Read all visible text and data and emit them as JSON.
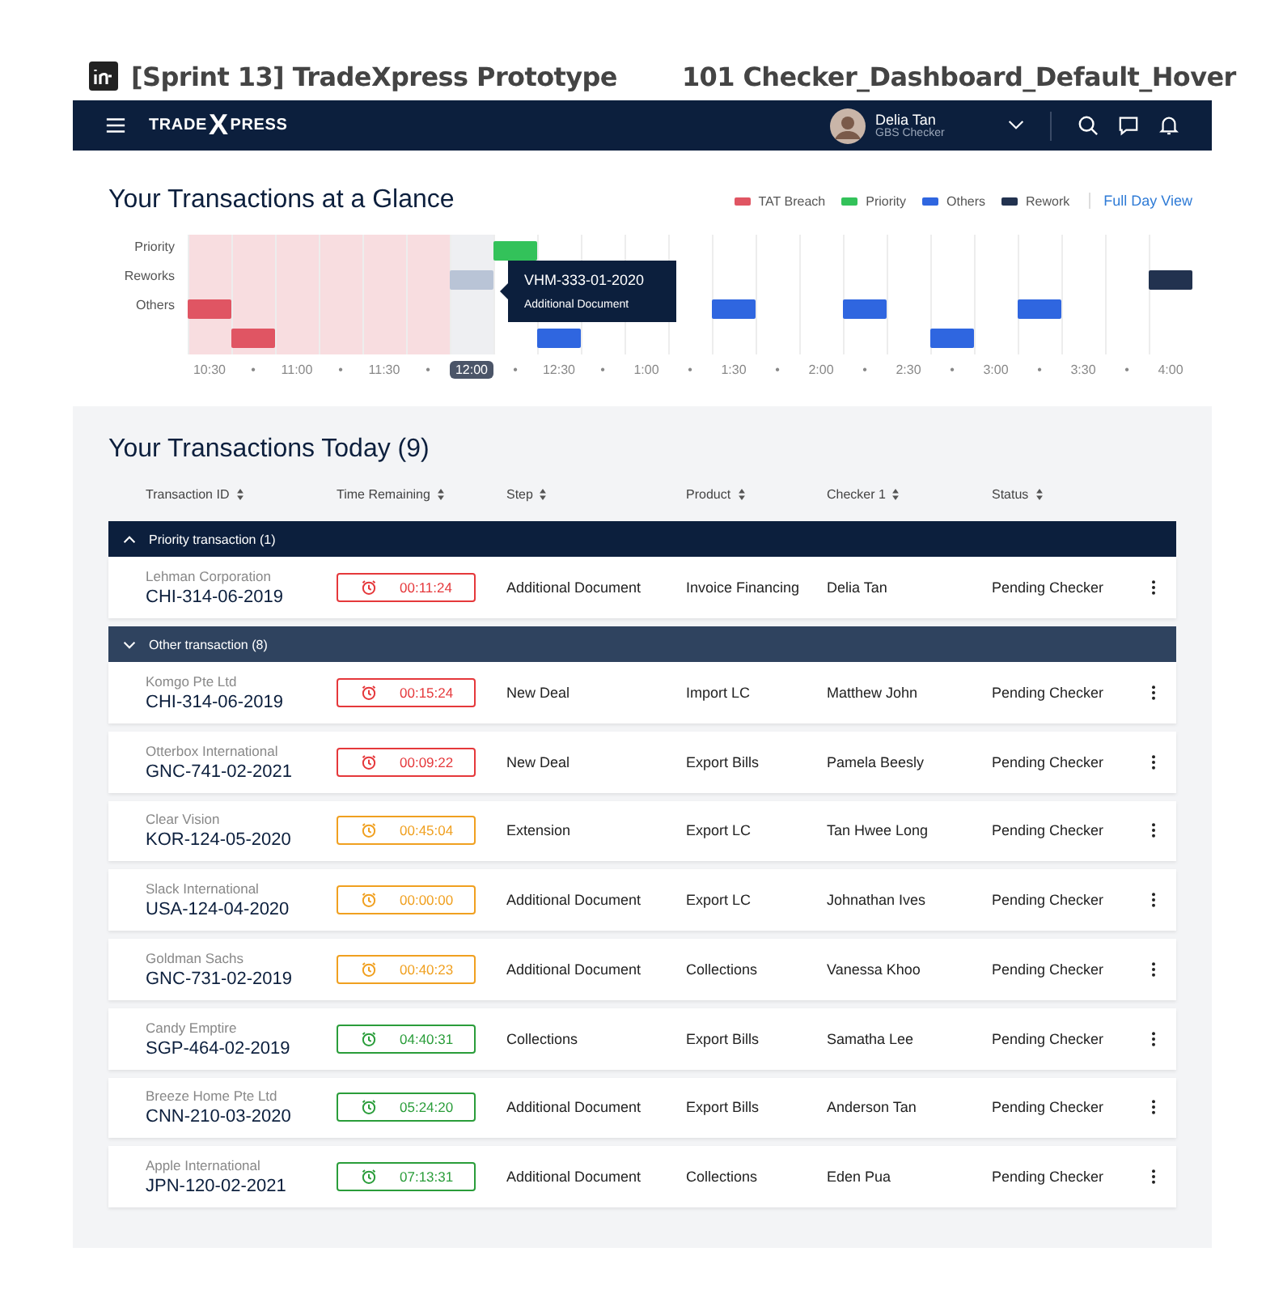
{
  "prototype": {
    "title": "[Sprint 13] TradeXpress Prototype",
    "screen": "101 Checker_Dashboard_Default_Hover"
  },
  "navbar": {
    "logo_left": "TRADE",
    "logo_mark": "X",
    "logo_right": "PRESS",
    "user": {
      "name": "Delia Tan",
      "role": "GBS Checker"
    }
  },
  "glance": {
    "title": "Your Transactions at a Glance",
    "legend": [
      {
        "label": "TAT Breach",
        "kind": "tat_breach"
      },
      {
        "label": "Priority",
        "kind": "priority"
      },
      {
        "label": "Others",
        "kind": "others"
      },
      {
        "label": "Rework",
        "kind": "rework"
      }
    ],
    "full_day_link": "Full Day View",
    "columns": [
      {
        "tick": "10:30",
        "past": true,
        "selected": false
      },
      {
        "tick": "•",
        "past": true,
        "selected": false
      },
      {
        "tick": "11:00",
        "past": true,
        "selected": false
      },
      {
        "tick": "•",
        "past": true,
        "selected": false
      },
      {
        "tick": "11:30",
        "past": true,
        "selected": false
      },
      {
        "tick": "•",
        "past": true,
        "selected": false
      },
      {
        "tick": "12:00",
        "past": false,
        "selected": true
      },
      {
        "tick": "•",
        "past": false,
        "selected": false
      },
      {
        "tick": "12:30",
        "past": false,
        "selected": false
      },
      {
        "tick": "•",
        "past": false,
        "selected": false
      },
      {
        "tick": "1:00",
        "past": false,
        "selected": false
      },
      {
        "tick": "•",
        "past": false,
        "selected": false
      },
      {
        "tick": "1:30",
        "past": false,
        "selected": false
      },
      {
        "tick": "•",
        "past": false,
        "selected": false
      },
      {
        "tick": "2:00",
        "past": false,
        "selected": false
      },
      {
        "tick": "•",
        "past": false,
        "selected": false
      },
      {
        "tick": "2:30",
        "past": false,
        "selected": false
      },
      {
        "tick": "•",
        "past": false,
        "selected": false
      },
      {
        "tick": "3:00",
        "past": false,
        "selected": false
      },
      {
        "tick": "•",
        "past": false,
        "selected": false
      },
      {
        "tick": "3:30",
        "past": false,
        "selected": false
      },
      {
        "tick": "•",
        "past": false,
        "selected": false
      },
      {
        "tick": "4:00",
        "past": false,
        "selected": false
      }
    ],
    "lanes": [
      {
        "label": "Priority",
        "slots": [
          {
            "kind": "none"
          },
          {
            "kind": "none"
          },
          {
            "kind": "none"
          },
          {
            "kind": "none"
          },
          {
            "kind": "none"
          },
          {
            "kind": "none"
          },
          {
            "kind": "none"
          },
          {
            "kind": "priority",
            "hovered": false
          },
          {
            "kind": "none"
          },
          {
            "kind": "none"
          },
          {
            "kind": "none"
          },
          {
            "kind": "none"
          },
          {
            "kind": "none"
          },
          {
            "kind": "none"
          },
          {
            "kind": "none"
          },
          {
            "kind": "none"
          },
          {
            "kind": "none"
          },
          {
            "kind": "none"
          },
          {
            "kind": "none"
          },
          {
            "kind": "none"
          },
          {
            "kind": "none"
          },
          {
            "kind": "none"
          },
          {
            "kind": "none"
          }
        ]
      },
      {
        "label": "Reworks",
        "slots": [
          {
            "kind": "none"
          },
          {
            "kind": "none"
          },
          {
            "kind": "none"
          },
          {
            "kind": "none"
          },
          {
            "kind": "none"
          },
          {
            "kind": "none"
          },
          {
            "kind": "rework",
            "hovered": true,
            "tooltip": {
              "id": "VHM-333-01-2020",
              "step": "Additional Document"
            }
          },
          {
            "kind": "none"
          },
          {
            "kind": "none"
          },
          {
            "kind": "none"
          },
          {
            "kind": "none"
          },
          {
            "kind": "none"
          },
          {
            "kind": "none"
          },
          {
            "kind": "none"
          },
          {
            "kind": "none"
          },
          {
            "kind": "none"
          },
          {
            "kind": "none"
          },
          {
            "kind": "none"
          },
          {
            "kind": "none"
          },
          {
            "kind": "none"
          },
          {
            "kind": "none"
          },
          {
            "kind": "none"
          },
          {
            "kind": "rework",
            "hovered": false
          }
        ]
      },
      {
        "label": "Others",
        "slots": [
          {
            "kind": "tat_breach",
            "hovered": false
          },
          {
            "kind": "none"
          },
          {
            "kind": "none"
          },
          {
            "kind": "none"
          },
          {
            "kind": "none"
          },
          {
            "kind": "none"
          },
          {
            "kind": "none"
          },
          {
            "kind": "none"
          },
          {
            "kind": "none"
          },
          {
            "kind": "none"
          },
          {
            "kind": "none"
          },
          {
            "kind": "none"
          },
          {
            "kind": "others",
            "hovered": false
          },
          {
            "kind": "none"
          },
          {
            "kind": "none"
          },
          {
            "kind": "others",
            "hovered": false
          },
          {
            "kind": "none"
          },
          {
            "kind": "none"
          },
          {
            "kind": "none"
          },
          {
            "kind": "others",
            "hovered": false
          },
          {
            "kind": "none"
          },
          {
            "kind": "none"
          },
          {
            "kind": "none"
          }
        ]
      },
      {
        "slots": [
          {
            "kind": "none"
          },
          {
            "kind": "tat_breach",
            "hovered": false
          },
          {
            "kind": "none"
          },
          {
            "kind": "none"
          },
          {
            "kind": "none"
          },
          {
            "kind": "none"
          },
          {
            "kind": "none"
          },
          {
            "kind": "none"
          },
          {
            "kind": "others",
            "hovered": false
          },
          {
            "kind": "none"
          },
          {
            "kind": "none"
          },
          {
            "kind": "none"
          },
          {
            "kind": "none"
          },
          {
            "kind": "none"
          },
          {
            "kind": "none"
          },
          {
            "kind": "none"
          },
          {
            "kind": "none"
          },
          {
            "kind": "others",
            "hovered": false
          },
          {
            "kind": "none"
          },
          {
            "kind": "none"
          },
          {
            "kind": "none"
          },
          {
            "kind": "none"
          },
          {
            "kind": "none"
          }
        ]
      }
    ]
  },
  "today": {
    "title": "Your Transactions Today (9)",
    "columns": [
      "Transaction ID",
      "Time Remaining",
      "Step",
      "Product",
      "Checker 1",
      "Status"
    ],
    "groups": [
      {
        "label": "Priority transaction (1)",
        "kind": "priority",
        "rows": [
          {
            "company": "Lehman Corporation",
            "id": "CHI-314-06-2019",
            "time": "00:11:24",
            "kind": "breach",
            "step": "Additional Document",
            "product": "Invoice Financing",
            "checker": "Delia Tan",
            "status": "Pending Checker"
          }
        ]
      },
      {
        "label": "Other transaction (8)",
        "kind": "other",
        "rows": [
          {
            "company": "Komgo Pte Ltd",
            "id": "CHI-314-06-2019",
            "time": "00:15:24",
            "kind": "breach",
            "step": "New Deal",
            "product": "Import LC",
            "checker": "Matthew John",
            "status": "Pending Checker"
          },
          {
            "company": "Otterbox International",
            "id": "GNC-741-02-2021",
            "time": "00:09:22",
            "kind": "breach",
            "step": "New Deal",
            "product": "Export Bills",
            "checker": "Pamela Beesly",
            "status": "Pending Checker"
          },
          {
            "company": "Clear Vision",
            "id": "KOR-124-05-2020",
            "time": "00:45:04",
            "kind": "warning",
            "step": "Extension",
            "product": "Export LC",
            "checker": "Tan Hwee Long",
            "status": "Pending Checker"
          },
          {
            "company": "Slack International",
            "id": "USA-124-04-2020",
            "time": "00:00:00",
            "kind": "warning",
            "step": "Additional Document",
            "product": "Export LC",
            "checker": "Johnathan Ives",
            "status": "Pending Checker"
          },
          {
            "company": "Goldman Sachs",
            "id": "GNC-731-02-2019",
            "time": "00:40:23",
            "kind": "warning",
            "step": "Additional Document",
            "product": "Collections",
            "checker": "Vanessa Khoo",
            "status": "Pending Checker"
          },
          {
            "company": "Candy Emptire",
            "id": "SGP-464-02-2019",
            "time": "04:40:31",
            "kind": "ok",
            "step": "Collections",
            "product": "Export Bills",
            "checker": "Samatha Lee",
            "status": "Pending Checker"
          },
          {
            "company": "Breeze Home Pte Ltd",
            "id": "CNN-210-03-2020",
            "time": "05:24:20",
            "kind": "ok",
            "step": "Additional Document",
            "product": "Export Bills",
            "checker": "Anderson Tan",
            "status": "Pending Checker"
          },
          {
            "company": "Apple International",
            "id": "JPN-120-02-2021",
            "time": "07:13:31",
            "kind": "ok",
            "step": "Additional Document",
            "product": "Collections",
            "checker": "Eden Pua",
            "status": "Pending Checker"
          }
        ]
      }
    ]
  }
}
